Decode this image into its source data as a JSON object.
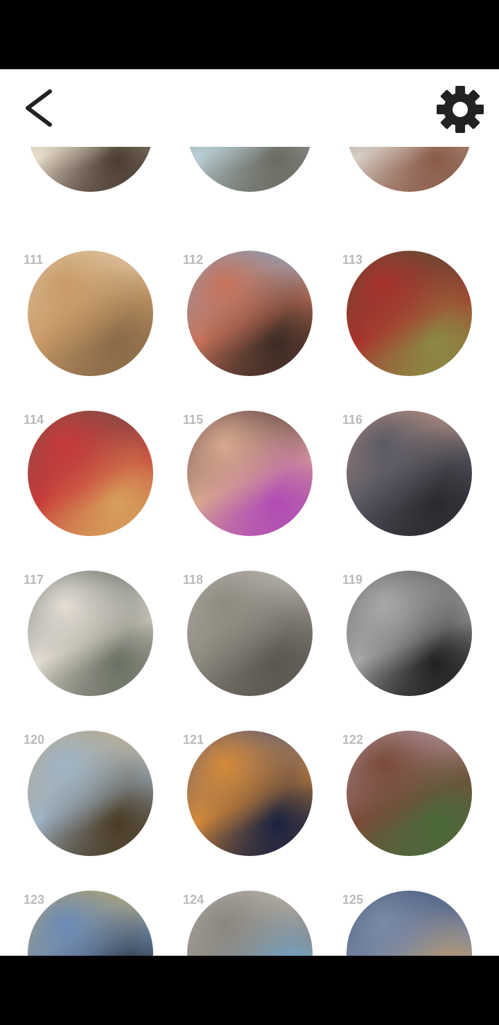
{
  "toolbar": {
    "back_icon": "chevron-left-icon",
    "settings_icon": "gear-icon"
  },
  "grid": {
    "partial_top_row": [
      {
        "image": "notebook-glasses-pencil",
        "colors": [
          "#a58a72",
          "#e8dccb",
          "#4a3b30"
        ]
      },
      {
        "image": "vintage-beetle-car",
        "colors": [
          "#2f4a2a",
          "#b9cfd6",
          "#6a6a60"
        ]
      },
      {
        "image": "hands-map-tablet",
        "colors": [
          "#3a2a24",
          "#d8cfc6",
          "#8a5a48"
        ]
      }
    ],
    "rows": [
      [
        {
          "number": "111",
          "image": "wooden-boat-on-beach",
          "colors": [
            "#e9d9bf",
            "#c99b68",
            "#8a6a48"
          ]
        },
        {
          "number": "112",
          "image": "buildings-looking-up-sky",
          "colors": [
            "#6ab5e6",
            "#c8735a",
            "#3b2b24"
          ]
        },
        {
          "number": "113",
          "image": "red-japanese-temple-lake",
          "colors": [
            "#3e5d3a",
            "#a8322c",
            "#8b8a45"
          ]
        }
      ],
      [
        {
          "number": "114",
          "image": "red-cocktails-table",
          "colors": [
            "#5e5a4e",
            "#c73a3a",
            "#d7a05a"
          ]
        },
        {
          "number": "115",
          "image": "hands-with-ring-ribbon",
          "colors": [
            "#3a2230",
            "#d7a88e",
            "#b14bb5"
          ]
        },
        {
          "number": "116",
          "image": "city-skyline-pier-sunset",
          "colors": [
            "#e0a88a",
            "#5a5a66",
            "#2a2a2e"
          ]
        }
      ],
      [
        {
          "number": "117",
          "image": "aerial-flower-shaped-building",
          "colors": [
            "#3a4a44",
            "#e4ddd4",
            "#6a7063"
          ]
        },
        {
          "number": "118",
          "image": "angular-building-facade",
          "colors": [
            "#c8c6c0",
            "#8f8a80",
            "#5a5650"
          ]
        },
        {
          "number": "119",
          "image": "curved-metal-architecture",
          "colors": [
            "#4a4a4a",
            "#a8a8a8",
            "#202020"
          ]
        }
      ],
      [
        {
          "number": "120",
          "image": "bench-by-lake-autumn",
          "colors": [
            "#c6a36c",
            "#9eb4c6",
            "#4a3a24"
          ]
        },
        {
          "number": "121",
          "image": "canal-warehouse-night",
          "colors": [
            "#2e4a8e",
            "#d48a3a",
            "#1a2240"
          ]
        },
        {
          "number": "122",
          "image": "pavilion-reflection-lake",
          "colors": [
            "#c8b6c8",
            "#7a4a3a",
            "#4a6a3a"
          ]
        }
      ],
      [
        {
          "number": "123",
          "image": "mirrored-building-sky",
          "colors": [
            "#d6b24a",
            "#6a8ab8",
            "#2a2a2a"
          ]
        },
        {
          "number": "124",
          "image": "old-street-buildings",
          "colors": [
            "#cbc6be",
            "#8a8680",
            "#6aaede"
          ]
        },
        {
          "number": "125",
          "image": "city-night-towers",
          "colors": [
            "#3a4a6a",
            "#7a8aa8",
            "#c89a5a"
          ]
        }
      ]
    ]
  }
}
